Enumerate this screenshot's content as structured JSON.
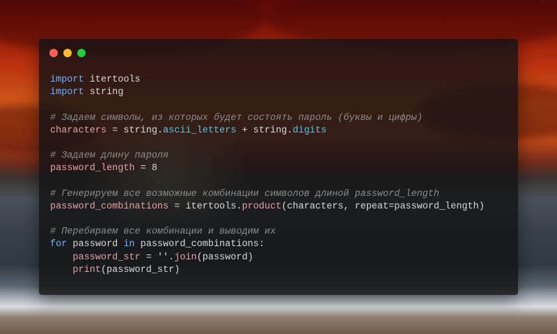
{
  "window": {
    "controls": [
      {
        "name": "close",
        "color": "#ff5f56"
      },
      {
        "name": "minimize",
        "color": "#ffbd2e"
      },
      {
        "name": "maximize",
        "color": "#27c93f"
      }
    ]
  },
  "code": {
    "lines": [
      [
        {
          "t": "import",
          "c": "kw"
        },
        {
          "t": " itertools",
          "c": "txt"
        }
      ],
      [
        {
          "t": "import",
          "c": "kw"
        },
        {
          "t": " string",
          "c": "txt"
        }
      ],
      [],
      [
        {
          "t": "# Задаем символы, из которых будет состоять пароль (буквы и цифры)",
          "c": "com"
        }
      ],
      [
        {
          "t": "characters",
          "c": "var"
        },
        {
          "t": " = string.",
          "c": "txt"
        },
        {
          "t": "ascii_letters",
          "c": "attr"
        },
        {
          "t": " + string.",
          "c": "txt"
        },
        {
          "t": "digits",
          "c": "attr"
        }
      ],
      [],
      [
        {
          "t": "# Задаем длину пароля",
          "c": "com"
        }
      ],
      [
        {
          "t": "password_length",
          "c": "var"
        },
        {
          "t": " = ",
          "c": "txt"
        },
        {
          "t": "8",
          "c": "num"
        }
      ],
      [],
      [
        {
          "t": "# Генерируем все возможные комбинации символов длиной password_length",
          "c": "com"
        }
      ],
      [
        {
          "t": "password_combinations",
          "c": "var"
        },
        {
          "t": " = itertools.",
          "c": "txt"
        },
        {
          "t": "product",
          "c": "fn"
        },
        {
          "t": "(characters, repeat=password_length)",
          "c": "txt"
        }
      ],
      [],
      [
        {
          "t": "# Перебираем все комбинации и выводим их",
          "c": "com"
        }
      ],
      [
        {
          "t": "for",
          "c": "kw"
        },
        {
          "t": " password ",
          "c": "txt"
        },
        {
          "t": "in",
          "c": "kw"
        },
        {
          "t": " password_combinations:",
          "c": "txt"
        }
      ],
      [
        {
          "t": "    ",
          "c": "txt"
        },
        {
          "t": "password_str",
          "c": "var"
        },
        {
          "t": " = ",
          "c": "txt"
        },
        {
          "t": "''",
          "c": "str"
        },
        {
          "t": ".",
          "c": "txt"
        },
        {
          "t": "join",
          "c": "fn"
        },
        {
          "t": "(password)",
          "c": "txt"
        }
      ],
      [
        {
          "t": "    ",
          "c": "txt"
        },
        {
          "t": "print",
          "c": "fn"
        },
        {
          "t": "(password_str)",
          "c": "txt"
        }
      ]
    ]
  }
}
